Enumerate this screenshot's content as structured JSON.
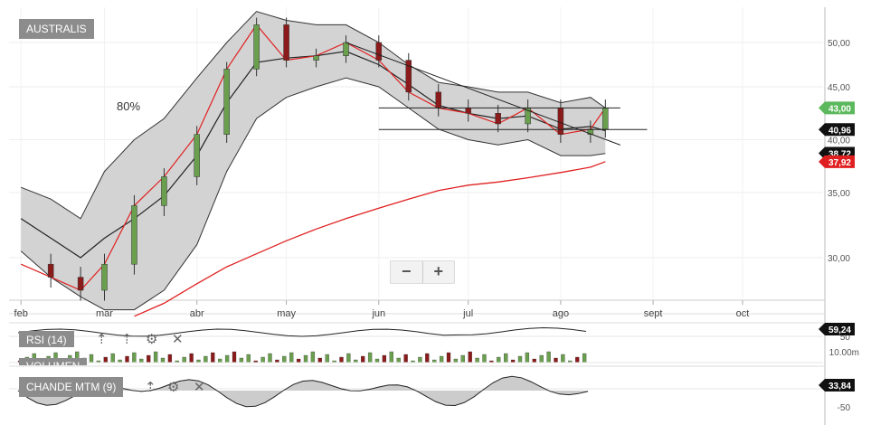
{
  "symbol": "AUSTRALIS",
  "annotation": "80%",
  "zoom": {
    "minus": "−",
    "plus": "+"
  },
  "months": [
    "feb",
    "mar",
    "abr",
    "may",
    "jun",
    "jul",
    "ago",
    "sept",
    "oct"
  ],
  "price_ticks": [
    "50,00",
    "45,00",
    "40,00",
    "35,00",
    "30,00"
  ],
  "badges": [
    {
      "label": "43,00",
      "color": "#5cb85c"
    },
    {
      "label": "40,96",
      "color": "#111111"
    },
    {
      "label": "38,72",
      "color": "#111111"
    },
    {
      "label": "37,92",
      "color": "#e02020"
    }
  ],
  "rsi": {
    "label": "RSI (14)",
    "tick": "50",
    "value": "59,24"
  },
  "volume": {
    "label": "VOLUMEN",
    "tick": "10.00m"
  },
  "cmo": {
    "label": "CHANDE MTM (9)",
    "tick": "-50",
    "value": "33,84"
  },
  "icons": {
    "gear": "⚙",
    "close": "✕",
    "pin": "⇡"
  },
  "colors": {
    "up": "#6a9f4e",
    "down": "#8b1a1a",
    "band_fill": "#d3d3d3",
    "sma200": "#e02020",
    "ema": "#e02020"
  },
  "chart_data": {
    "type": "candlestick",
    "ylim": [
      26.5,
      53.5
    ],
    "x": [
      "2019-02-01",
      "2019-02-11",
      "2019-02-21",
      "2019-03-01",
      "2019-03-11",
      "2019-03-21",
      "2019-04-01",
      "2019-04-11",
      "2019-04-21",
      "2019-05-01",
      "2019-05-11",
      "2019-05-21",
      "2019-06-01",
      "2019-06-11",
      "2019-06-21",
      "2019-07-01",
      "2019-07-11",
      "2019-07-21",
      "2019-08-01",
      "2019-08-11",
      "2019-08-16"
    ],
    "close": [
      29.5,
      28.5,
      27.5,
      29.5,
      34.0,
      36.5,
      40.5,
      47.0,
      52.0,
      48.0,
      48.5,
      50.0,
      48.0,
      44.5,
      43.0,
      42.5,
      41.5,
      43.0,
      40.5,
      41.0,
      43.0
    ],
    "bb_upper": [
      35.5,
      34.5,
      33.0,
      37.0,
      40.0,
      42.0,
      46.0,
      50.0,
      53.5,
      52.5,
      52.0,
      52.0,
      50.0,
      47.5,
      45.5,
      45.0,
      44.5,
      44.5,
      43.5,
      44.0,
      43.0
    ],
    "bb_lower": [
      30.5,
      28.5,
      27.0,
      26.0,
      26.0,
      27.5,
      31.0,
      37.0,
      42.0,
      44.0,
      45.0,
      46.0,
      45.0,
      43.0,
      41.0,
      40.0,
      39.5,
      40.0,
      38.5,
      38.5,
      38.7
    ],
    "sma200": [
      null,
      null,
      null,
      null,
      25.5,
      26.5,
      28.0,
      29.3,
      30.3,
      31.3,
      32.2,
      33.0,
      33.8,
      34.5,
      35.2,
      35.7,
      36.0,
      36.4,
      36.9,
      37.4,
      37.92
    ],
    "trendlines": [
      {
        "x": [
          "2019-05-21",
          "2019-08-21"
        ],
        "y": [
          50.0,
          39.5
        ]
      },
      {
        "x": [
          "2019-06-01",
          "2019-08-21"
        ],
        "y": [
          43.0,
          43.0
        ]
      },
      {
        "x": [
          "2019-06-01",
          "2019-08-30"
        ],
        "y": [
          40.96,
          40.96
        ]
      }
    ],
    "rsi_value": 59.24,
    "cmo_value": 33.84
  }
}
